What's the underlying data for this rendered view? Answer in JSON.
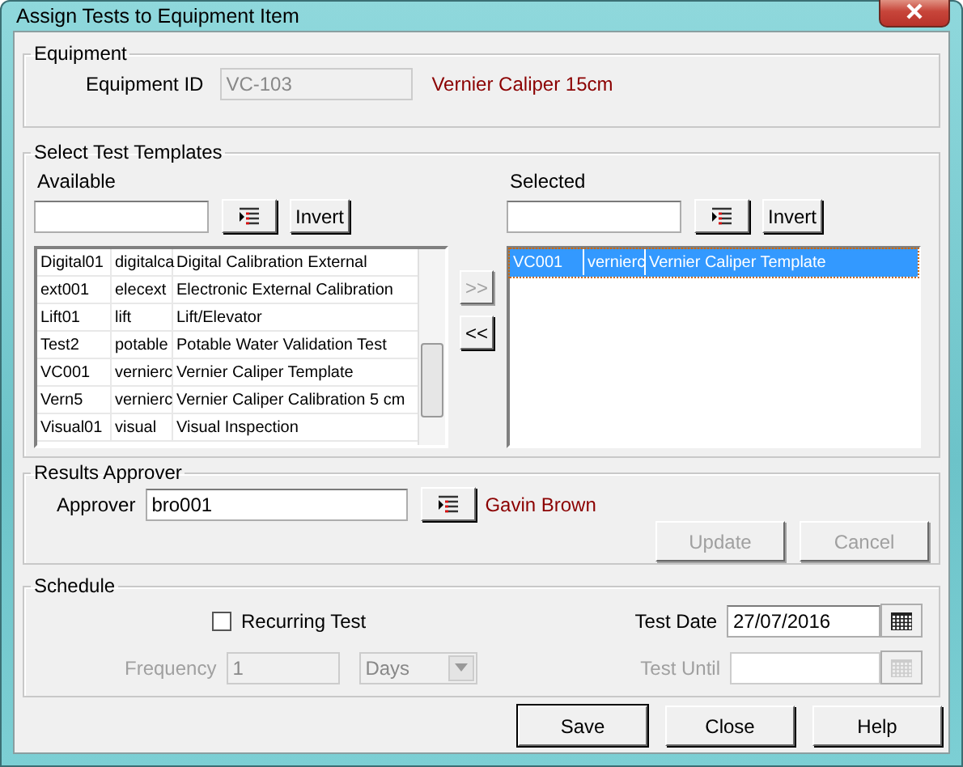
{
  "window": {
    "title": "Assign Tests to Equipment Item"
  },
  "equipment": {
    "group_title": "Equipment",
    "id_label": "Equipment ID",
    "id_value": "VC-103",
    "id_disabled": true,
    "description": "Vernier Caliper 15cm"
  },
  "templates": {
    "group_title": "Select Test Templates",
    "available": {
      "label": "Available",
      "invert_button": "Invert",
      "rows": [
        {
          "code": "Digital01",
          "type": "digitalca",
          "name": "Digital Calibration External",
          "selected": false
        },
        {
          "code": "ext001",
          "type": "elecext",
          "name": "Electronic External Calibration",
          "selected": false
        },
        {
          "code": "Lift01",
          "type": "lift",
          "name": "Lift/Elevator",
          "selected": false
        },
        {
          "code": "Test2",
          "type": "potable",
          "name": "Potable Water Validation Test",
          "selected": false
        },
        {
          "code": "VC001",
          "type": "vernierc",
          "name": "Vernier Caliper Template",
          "selected": false
        },
        {
          "code": "Vern5",
          "type": "vernierc",
          "name": "Vernier Caliper Calibration 5 cm",
          "selected": false
        },
        {
          "code": "Visual01",
          "type": "visual",
          "name": "Visual Inspection",
          "selected": false
        }
      ]
    },
    "add_button": {
      "label": ">>",
      "disabled": true
    },
    "remove_button": {
      "label": "<<",
      "disabled": false
    },
    "selected": {
      "label": "Selected",
      "invert_button": "Invert",
      "rows": [
        {
          "code": "VC001",
          "type": "vernierc",
          "name": "Vernier Caliper Template",
          "selected": true
        }
      ]
    }
  },
  "approver": {
    "group_title": "Results Approver",
    "label": "Approver",
    "value": "bro001",
    "name": "Gavin Brown",
    "update_button": {
      "label": "Update",
      "disabled": true
    },
    "cancel_button": {
      "label": "Cancel",
      "disabled": true
    }
  },
  "schedule": {
    "group_title": "Schedule",
    "recurring": {
      "label": "Recurring Test",
      "checked": false
    },
    "frequency": {
      "label": "Frequency",
      "value": "1",
      "disabled": true
    },
    "unit": {
      "value": "Days",
      "disabled": true
    },
    "test_date": {
      "label": "Test Date",
      "value": "27/07/2016",
      "disabled": false
    },
    "test_until": {
      "label": "Test Until",
      "disabled": true
    }
  },
  "buttons": [
    {
      "label": "Save",
      "default": true
    },
    {
      "label": "Close",
      "default": false
    },
    {
      "label": "Help",
      "default": false
    }
  ]
}
